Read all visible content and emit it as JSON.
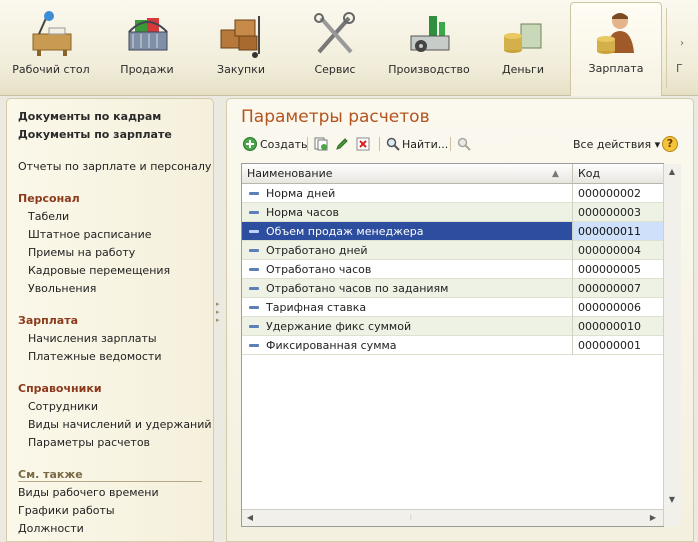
{
  "sections": [
    {
      "label": "Рабочий стол",
      "icon": "desktop-icon"
    },
    {
      "label": "Продажи",
      "icon": "shopping-basket-icon"
    },
    {
      "label": "Закупки",
      "icon": "boxes-cart-icon"
    },
    {
      "label": "Сервис",
      "icon": "tools-icon"
    },
    {
      "label": "Производство",
      "icon": "factory-icon"
    },
    {
      "label": "Деньги",
      "icon": "money-icon"
    },
    {
      "label": "Зарплата",
      "icon": "salary-person-icon",
      "active": true
    }
  ],
  "left_panel": {
    "docs_hr": "Документы по кадрам",
    "docs_salary": "Документы по зарплате",
    "reports": "Отчеты по зарплате и персоналу",
    "group_personnel": {
      "title": "Персонал",
      "items": [
        "Табели",
        "Штатное расписание",
        "Приемы на работу",
        "Кадровые перемещения",
        "Увольнения"
      ]
    },
    "group_salary": {
      "title": "Зарплата",
      "items": [
        "Начисления зарплаты",
        "Платежные ведомости"
      ]
    },
    "group_refs": {
      "title": "Справочники",
      "items": [
        "Сотрудники",
        "Виды начислений и удержаний",
        "Параметры расчетов"
      ]
    },
    "see_also": {
      "title": "См. также",
      "items": [
        "Виды рабочего времени",
        "Графики работы",
        "Должности"
      ]
    }
  },
  "main": {
    "title": "Параметры расчетов",
    "toolbar": {
      "create": "Создать",
      "find": "Найти...",
      "all_actions": "Все действия ▾",
      "help": "?"
    },
    "table": {
      "col_name": "Наименование",
      "col_code": "Код",
      "selected_index": 2,
      "rows": [
        {
          "name": "Норма дней",
          "code": "000000002"
        },
        {
          "name": "Норма часов",
          "code": "000000003"
        },
        {
          "name": "Объем продаж менеджера",
          "code": "000000011"
        },
        {
          "name": "Отработано дней",
          "code": "000000004"
        },
        {
          "name": "Отработано часов",
          "code": "000000005"
        },
        {
          "name": "Отработано часов по заданиям",
          "code": "000000007"
        },
        {
          "name": "Тарифная ставка",
          "code": "000000006"
        },
        {
          "name": "Удержание фикс суммой",
          "code": "000000010"
        },
        {
          "name": "Фиксированная сумма",
          "code": "000000001"
        }
      ]
    }
  },
  "colors": {
    "title_orange": "#b3541e",
    "group_header": "#8b3a1c",
    "selection_blue": "#2d4e9e",
    "row_alt": "#eef2e4"
  }
}
